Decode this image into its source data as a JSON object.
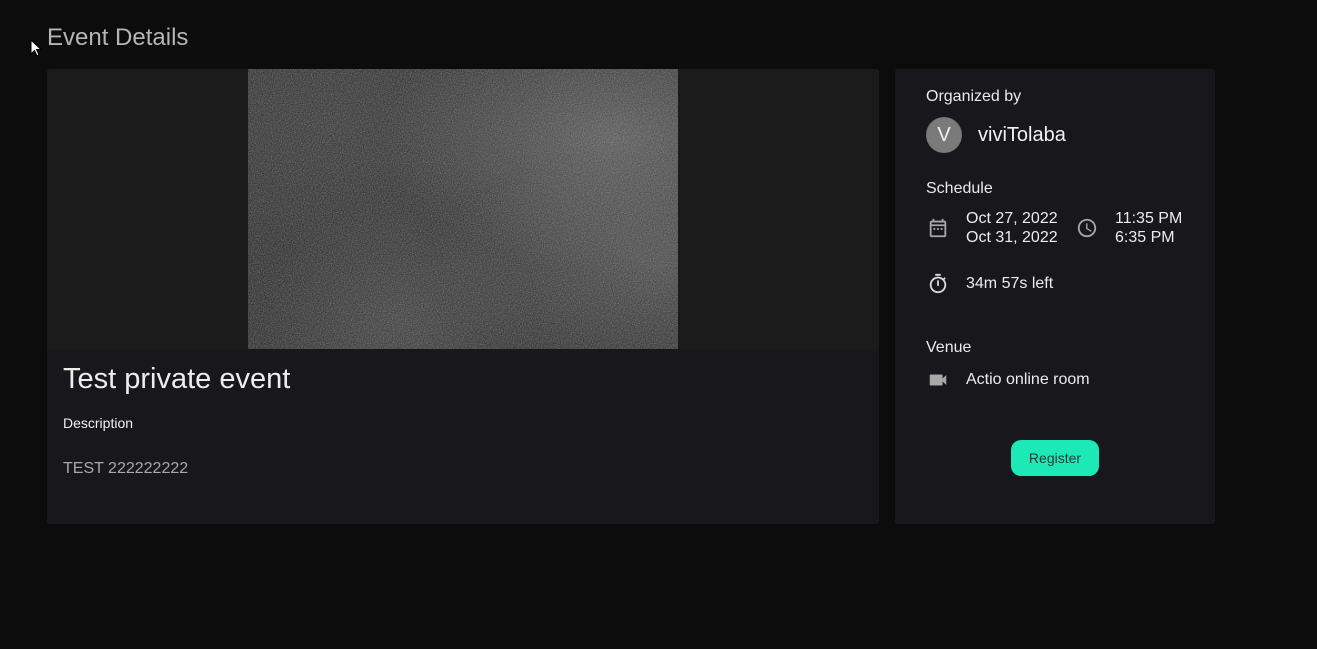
{
  "page": {
    "title": "Event Details"
  },
  "event": {
    "title": "Test private event",
    "description_label": "Description",
    "description": "TEST 222222222"
  },
  "sidebar": {
    "organized_by_label": "Organized by",
    "organizer_initial": "V",
    "organizer_name": "viviTolaba",
    "schedule_label": "Schedule",
    "start_date": "Oct 27, 2022",
    "end_date": "Oct 31, 2022",
    "start_time": "11:35 PM",
    "end_time": "6:35 PM",
    "time_left": "34m 57s left",
    "venue_label": "Venue",
    "venue": "Actio online room",
    "register_label": "Register"
  },
  "icons": {
    "calendar": "calendar-icon",
    "clock": "clock-icon",
    "timer": "timer-icon",
    "video": "video-camera-icon"
  },
  "colors": {
    "background": "#0c0c0c",
    "card": "#18181c",
    "accent": "#1de9b6",
    "avatar": "#7a7a7a"
  }
}
